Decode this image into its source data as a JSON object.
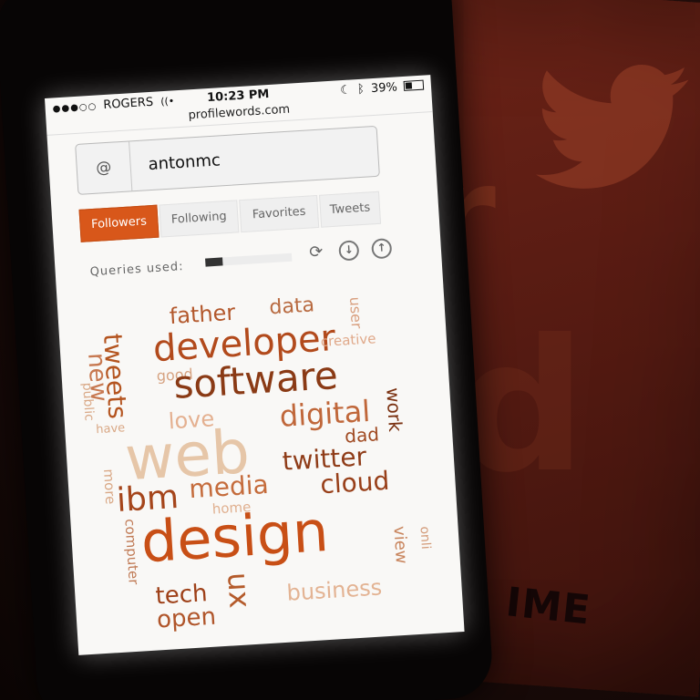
{
  "background": {
    "poster_letters": [
      "r",
      "d"
    ],
    "poster_word": "IME",
    "bird": "twitter-bird-icon"
  },
  "status_bar": {
    "carrier": "ROGERS",
    "signal": "signal-dots-icon",
    "wifi": "wifi-icon",
    "time": "10:23 PM",
    "moon": "moon-icon",
    "bluetooth": "bluetooth-icon",
    "battery": "39%"
  },
  "browser": {
    "url": "profilewords.com"
  },
  "handle_input": {
    "prefix": "@",
    "value": "antonmc"
  },
  "tabs": [
    {
      "label": "Followers",
      "active": true
    },
    {
      "label": "Following",
      "active": false
    },
    {
      "label": "Favorites",
      "active": false
    },
    {
      "label": "Tweets",
      "active": false
    }
  ],
  "queries": {
    "label": "Queries used:",
    "fraction": 0.2
  },
  "actions": {
    "refresh": "refresh-icon",
    "download": "download-icon",
    "upload": "upload-icon"
  },
  "word_cloud": {
    "accent": "#d8571a",
    "words": [
      "father",
      "data",
      "user",
      "developer",
      "creative",
      "tweets",
      "new",
      "good",
      "software",
      "public",
      "have",
      "love",
      "work",
      "digital",
      "dad",
      "web",
      "twitter",
      "more",
      "media",
      "ibm",
      "cloud",
      "home",
      "computer",
      "design",
      "view",
      "onli",
      "tech",
      "ux",
      "open",
      "business"
    ]
  }
}
